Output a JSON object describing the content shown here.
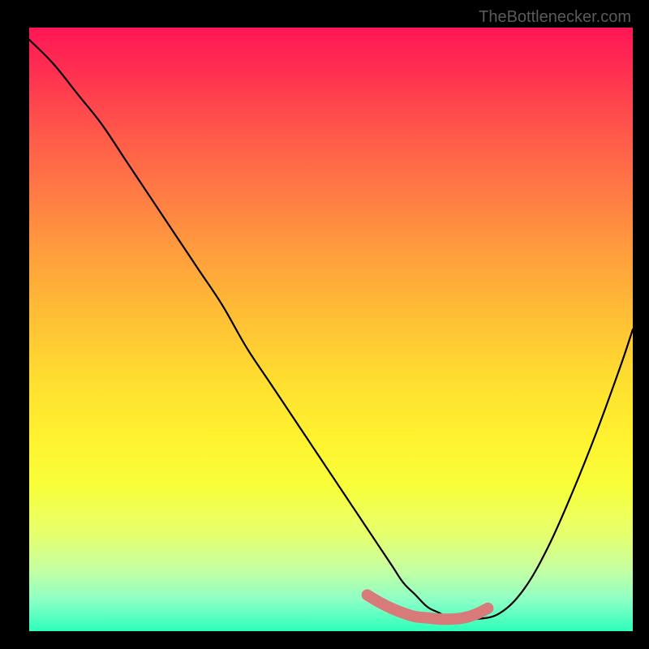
{
  "attribution": "TheBottlenecker.com",
  "chart_data": {
    "type": "line",
    "title": "",
    "xlabel": "",
    "ylabel": "",
    "xlim": [
      0,
      100
    ],
    "ylim": [
      0,
      100
    ],
    "series": [
      {
        "name": "curve",
        "x": [
          0,
          4,
          8,
          12,
          16,
          20,
          24,
          28,
          32,
          36,
          40,
          44,
          48,
          52,
          56,
          60,
          62,
          64,
          66,
          68,
          70,
          74,
          78,
          82,
          86,
          90,
          94,
          98,
          100
        ],
        "values": [
          98,
          94,
          89,
          84,
          78,
          72,
          66,
          60,
          54,
          47,
          41,
          35,
          29,
          23,
          17,
          11,
          8,
          6,
          4,
          3,
          2,
          2,
          3,
          7,
          14,
          23,
          33,
          44,
          50
        ]
      },
      {
        "name": "highlight",
        "x": [
          56,
          58,
          60,
          62,
          64,
          66,
          68,
          70,
          72,
          74,
          76
        ],
        "values": [
          6,
          4.8,
          3.8,
          3.0,
          2.4,
          2.2,
          2.0,
          2.0,
          2.2,
          2.8,
          3.8
        ]
      }
    ],
    "highlight_color": "#d97a7a",
    "curve_color": "#000000"
  }
}
